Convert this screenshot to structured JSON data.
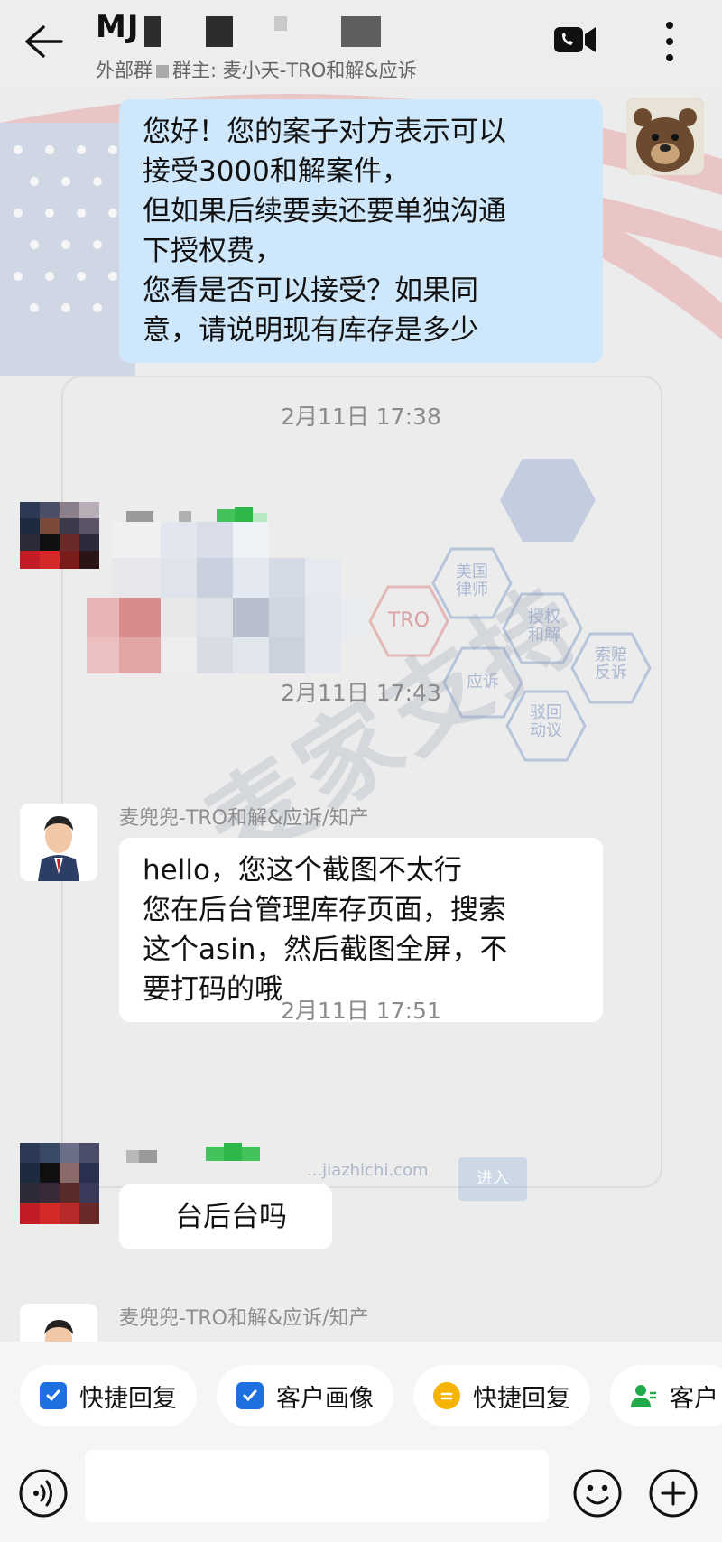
{
  "header": {
    "title": "MJ",
    "subtitle_prefix": "外部群",
    "subtitle_owner": "群主: 麦小天-TRO和解&应诉"
  },
  "messages": [
    {
      "type": "outgoing",
      "lines": [
        "您好！您的案子对方表示可以",
        "接受3000和解案件，",
        "但如果后续要卖还要单独沟通",
        "下授权费，",
        "您看是否可以接受？如果同",
        "意，请说明现有库存是多少"
      ]
    },
    {
      "type": "timestamp",
      "text": "2月11日  17:38"
    },
    {
      "type": "timestamp",
      "text": "2月11日  17:43"
    },
    {
      "type": "incoming",
      "sender": "麦兜兜-TRO和解&应诉/知产",
      "lines": [
        "hello，您这个截图不太行",
        "您在后台管理库存页面，搜索",
        "这个asin，然后截图全屏，不",
        "要打码的哦"
      ]
    },
    {
      "type": "timestamp",
      "text": "2月11日  17:51"
    },
    {
      "type": "incoming",
      "lines": [
        "台后台吗"
      ]
    },
    {
      "type": "incoming",
      "sender": "麦兜兜-TRO和解&应诉/知产"
    }
  ],
  "background": {
    "watermark": "麦家支持",
    "hex_labels": [
      "美国律师",
      "授权和解",
      "应诉",
      "驳回动议",
      "索赔反诉",
      "TRO"
    ],
    "url": "...jiazhichi.com",
    "enter_label": "进入"
  },
  "quick_replies": [
    {
      "label": "快捷回复",
      "icon": "check-square-icon",
      "color": "#1e6fe0"
    },
    {
      "label": "客户画像",
      "icon": "check-square-icon",
      "color": "#1e6fe0"
    },
    {
      "label": "快捷回复",
      "icon": "note-icon",
      "color": "#f5b400"
    },
    {
      "label": "客户",
      "icon": "person-icon",
      "color": "#21a94a"
    }
  ],
  "input": {
    "placeholder": ""
  },
  "colors": {
    "outgoing_bubble": "#cfe7fb",
    "incoming_bubble": "#ffffff",
    "background": "#ededed"
  }
}
